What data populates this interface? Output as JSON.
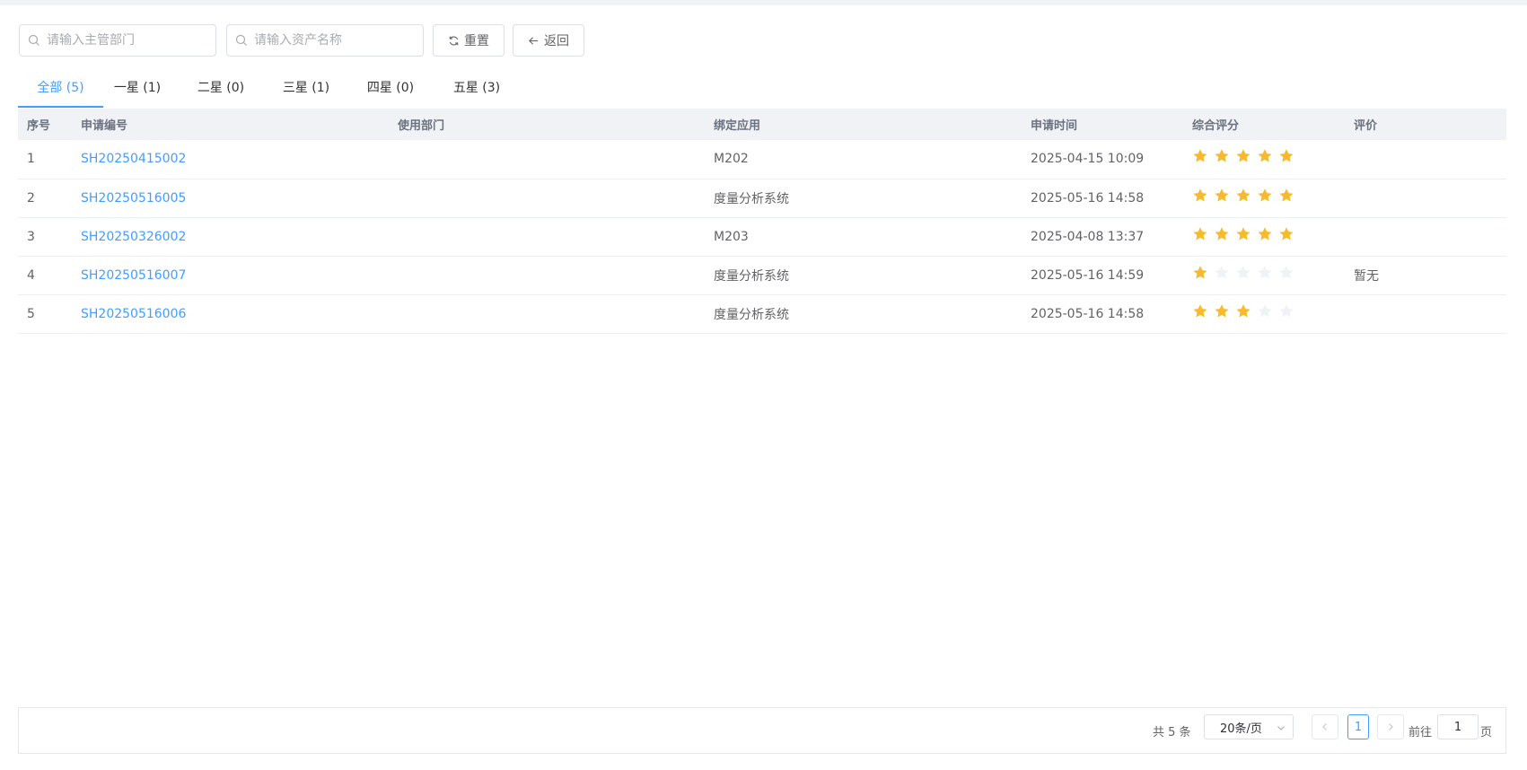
{
  "toolbar": {
    "dept_placeholder": "请输入主管部门",
    "asset_placeholder": "请输入资产名称",
    "reset_label": "重置",
    "back_label": "返回"
  },
  "tabs": [
    {
      "label": "全部 (5)",
      "active": true
    },
    {
      "label": "一星 (1)",
      "active": false
    },
    {
      "label": "二星 (0)",
      "active": false
    },
    {
      "label": "三星 (1)",
      "active": false
    },
    {
      "label": "四星 (0)",
      "active": false
    },
    {
      "label": "五星 (3)",
      "active": false
    }
  ],
  "table": {
    "columns": [
      "序号",
      "申请编号",
      "使用部门",
      "绑定应用",
      "申请时间",
      "综合评分",
      "评价"
    ],
    "rows": [
      {
        "index": "1",
        "code": "SH20250415002",
        "dept": "",
        "app": "M202",
        "time": "2025-04-15 10:09",
        "rating": 5,
        "comment": ""
      },
      {
        "index": "2",
        "code": "SH20250516005",
        "dept": "",
        "app": "度量分析系统",
        "time": "2025-05-16 14:58",
        "rating": 5,
        "comment": ""
      },
      {
        "index": "3",
        "code": "SH20250326002",
        "dept": "",
        "app": "M203",
        "time": "2025-04-08 13:37",
        "rating": 5,
        "comment": ""
      },
      {
        "index": "4",
        "code": "SH20250516007",
        "dept": "",
        "app": "度量分析系统",
        "time": "2025-05-16 14:59",
        "rating": 1,
        "comment": "暂无"
      },
      {
        "index": "5",
        "code": "SH20250516006",
        "dept": "",
        "app": "度量分析系统",
        "time": "2025-05-16 14:58",
        "rating": 3,
        "comment": ""
      }
    ],
    "max_rating": 5
  },
  "pagination": {
    "total": "共 5 条",
    "page_size": "20条/页",
    "current_page": "1",
    "goto_label": "前往",
    "goto_value": "1",
    "page_suffix": "页"
  },
  "colors": {
    "accent": "#409eff",
    "star_on": "#f7ba2a",
    "star_off": "#eff2f7"
  },
  "icons": {
    "search": "search-icon",
    "reset": "refresh-icon",
    "back": "arrow-left-icon",
    "prev": "chevron-left-icon",
    "next": "chevron-right-icon",
    "dropdown": "chevron-down-icon"
  }
}
